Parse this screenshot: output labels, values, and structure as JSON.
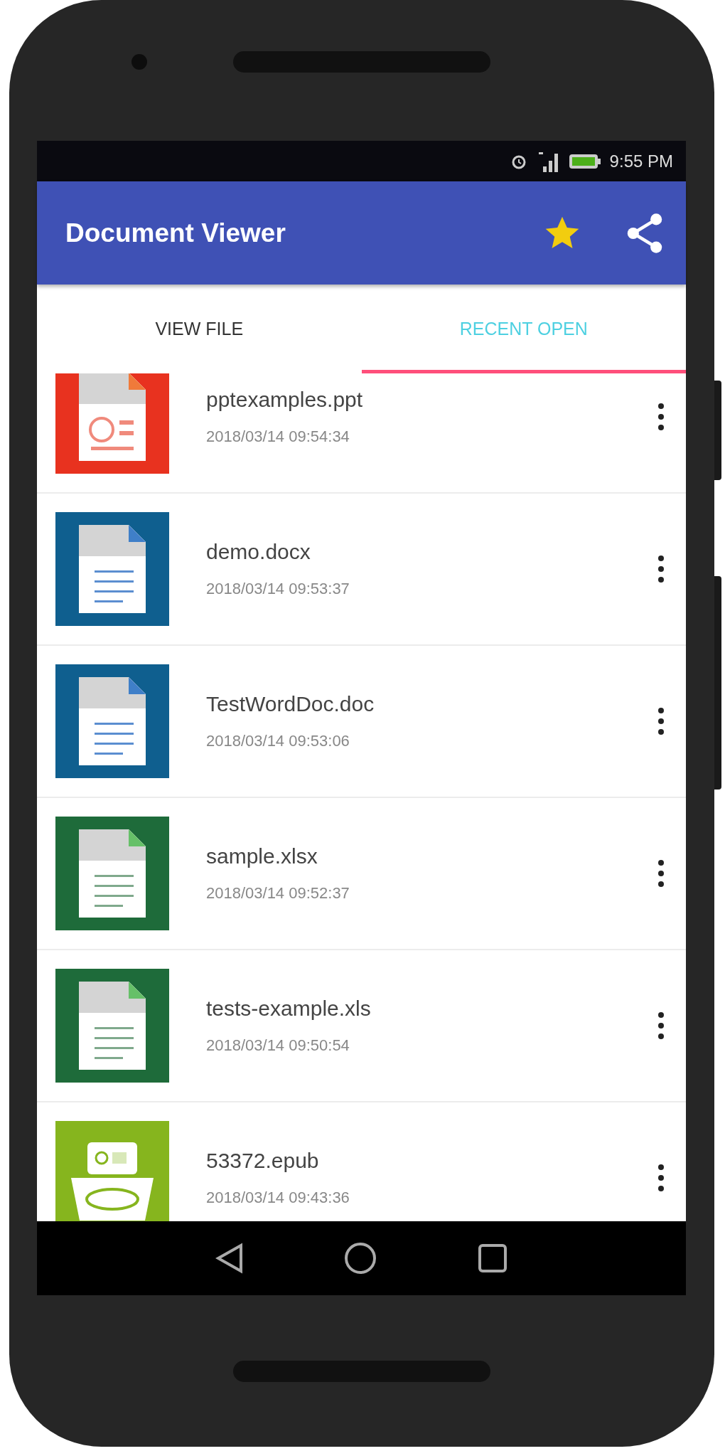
{
  "status_bar": {
    "time": "9:55 PM"
  },
  "app_bar": {
    "title": "Document Viewer"
  },
  "tabs": [
    {
      "label": "VIEW FILE",
      "selected": false
    },
    {
      "label": "RECENT OPEN",
      "selected": true
    }
  ],
  "files": [
    {
      "kind": "ppt",
      "name": "pptexamples.ppt",
      "date": "2018/03/14 09:54:34"
    },
    {
      "kind": "doc",
      "name": "demo.docx",
      "date": "2018/03/14 09:53:37"
    },
    {
      "kind": "doc",
      "name": "TestWordDoc.doc",
      "date": "2018/03/14 09:53:06"
    },
    {
      "kind": "xls",
      "name": "sample.xlsx",
      "date": "2018/03/14 09:52:37"
    },
    {
      "kind": "xls",
      "name": "tests-example.xls",
      "date": "2018/03/14 09:50:54"
    },
    {
      "kind": "epub",
      "name": "53372.epub",
      "date": "2018/03/14 09:43:36"
    }
  ]
}
